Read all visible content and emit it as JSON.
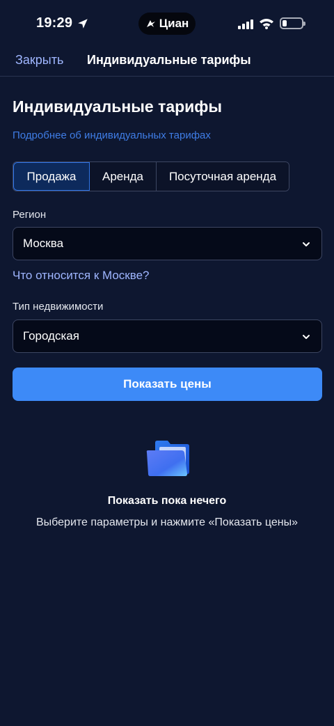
{
  "status_bar": {
    "time": "19:29",
    "app_badge": "Циан",
    "battery_level": 0.22
  },
  "nav": {
    "close_label": "Закрыть",
    "title": "Индивидуальные тарифы"
  },
  "page": {
    "title": "Индивидуальные тарифы",
    "info_link": "Подробнее об индивидуальных тарифах"
  },
  "deal_tabs": {
    "items": [
      {
        "label": "Продажа",
        "selected": true
      },
      {
        "label": "Аренда",
        "selected": false
      },
      {
        "label": "Посуточная аренда",
        "selected": false
      }
    ]
  },
  "region": {
    "label": "Регион",
    "value": "Москва",
    "help_link": "Что относится к Москве?"
  },
  "property_type": {
    "label": "Тип недвижимости",
    "value": "Городская"
  },
  "show_prices_button": "Показать цены",
  "empty_state": {
    "icon": "folder-icon",
    "title": "Показать пока нечего",
    "description": "Выберите параметры и нажмите «Показать цены»"
  },
  "colors": {
    "background": "#0e1730",
    "accent": "#3d8af7",
    "link": "#3f7de6",
    "active_tab": "#0d2a5c"
  }
}
